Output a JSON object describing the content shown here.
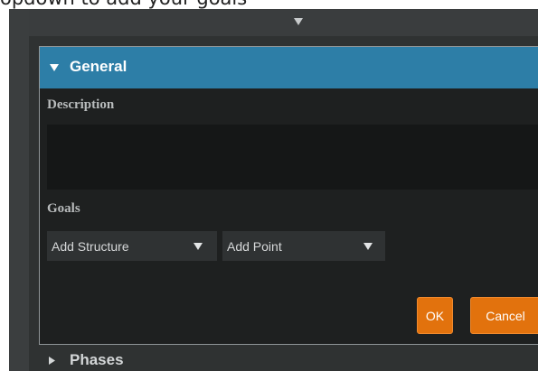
{
  "caption": {
    "text": "opdown to add your goals"
  },
  "toolbar": {
    "grip_icon": "triangle-down-icon"
  },
  "general": {
    "title": "General",
    "caret_icon": "triangle-down-icon",
    "description_label": "Description",
    "description_value": "",
    "goals_label": "Goals",
    "structure_select": {
      "selected": "Add Structure",
      "arrow_icon": "triangle-down-icon"
    },
    "point_select": {
      "selected": "Add Point",
      "arrow_icon": "triangle-down-icon"
    },
    "ok_label": "OK",
    "cancel_label": "Cancel"
  },
  "phases": {
    "title": "Phases",
    "caret_icon": "triangle-right-icon"
  },
  "colors": {
    "header_blue": "#2d7ea7",
    "button_orange": "#e2720d",
    "panel_dark": "#1e2020",
    "app_background": "#2f3232"
  }
}
